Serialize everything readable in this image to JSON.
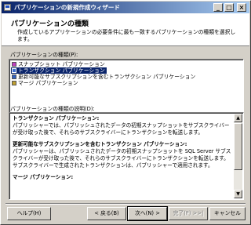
{
  "window": {
    "title": "パブリケーションの新規作成ウィザード"
  },
  "header": {
    "title": "パブリケーションの種類",
    "description": "作成しているアプリケーションの必要条件に最も一致するパブリケーションの種類を選択します。"
  },
  "list": {
    "label": "パブリケーションの種類(P):",
    "items": [
      {
        "label": "スナップショット パブリケーション",
        "icon": "snapshot-publication-icon",
        "selected": false
      },
      {
        "label": "トランザクション パブリケーション",
        "icon": "transactional-publication-icon",
        "selected": true
      },
      {
        "label": "更新可能なサブスクリプションを含むトランザクション パブリケーション",
        "icon": "updatable-publication-icon",
        "selected": false
      },
      {
        "label": "マージ パブリケーション",
        "icon": "merge-publication-icon",
        "selected": false
      }
    ]
  },
  "description_box": {
    "label": "パブリケーションの種類の説明(D):",
    "sections": [
      {
        "heading": "トランザクション パブリケーション:",
        "body": "パブリッシャーでは、パブリッシュされたデータの初期スナップショットをサブスクライバーが受け取った後で、それらのサブスクライバーにトランザクションを転送します。"
      },
      {
        "heading": "更新可能なサブスクリプションを含むトランザクション パブリケーション:",
        "body": "パブリッシャーは、パブリッシュされたデータの初期スナップショットを SQL Server サブスクライバーが受け取った後で、それらのサブスクライバーにトランザクションを転送します。サブスクライバーで生成されたトランザクションは、パブリッシャーで適用されます。"
      },
      {
        "heading": "マージ パブリケーション:",
        "body": ""
      }
    ]
  },
  "buttons": {
    "help": "ヘルプ(H)",
    "back": "< 戻る(B)",
    "next": "次へ(N) >",
    "finish": "完了(F) >>|",
    "cancel": "キャンセル"
  }
}
